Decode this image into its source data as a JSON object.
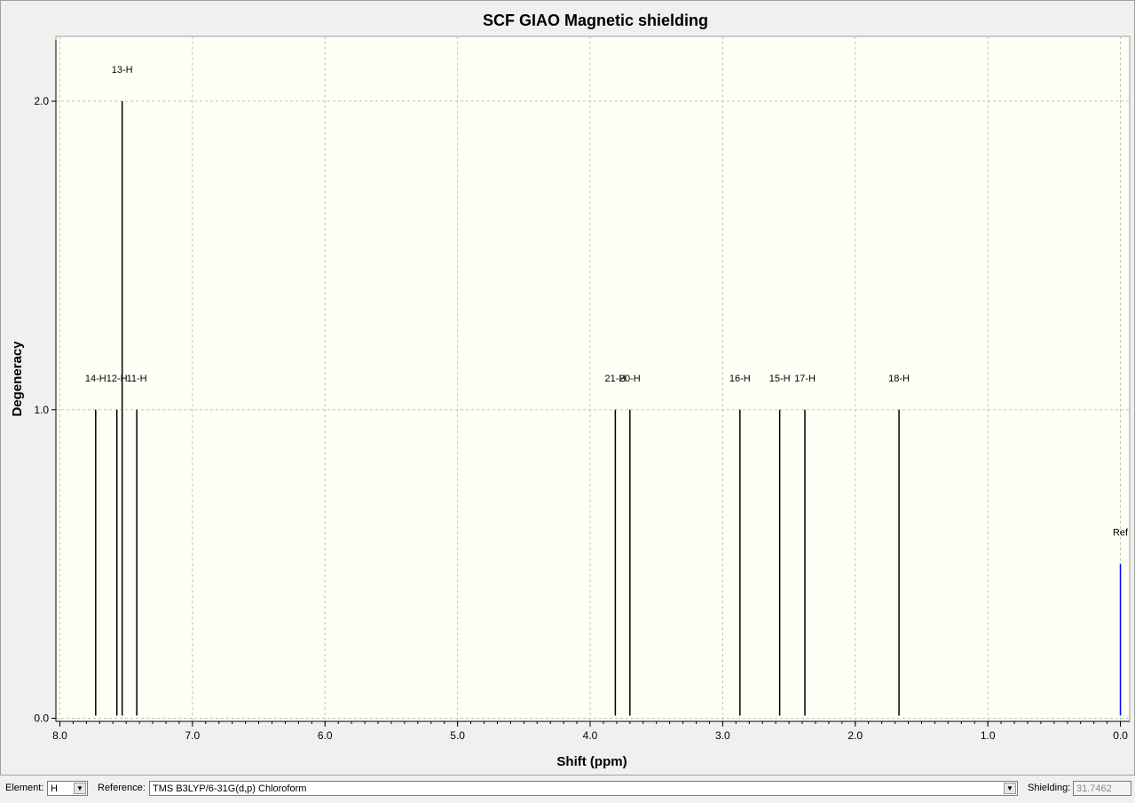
{
  "chart_data": {
    "type": "bar",
    "title": "SCF GIAO Magnetic shielding",
    "xlabel": "Shift (ppm)",
    "ylabel": "Degeneracy",
    "xlim": [
      8.03,
      -0.07
    ],
    "ylim": [
      -0.01,
      2.21
    ],
    "xticks": [
      "8.0",
      "7.0",
      "6.0",
      "5.0",
      "4.0",
      "3.0",
      "2.0",
      "1.0",
      "0.0"
    ],
    "yticks": [
      "0.0",
      "1.0",
      "2.0"
    ],
    "grid": true,
    "peaks": [
      {
        "label": "14-H",
        "x": 7.73,
        "y": 1
      },
      {
        "label": "12-H",
        "x": 7.57,
        "y": 1
      },
      {
        "label": "13-H",
        "x": 7.53,
        "y": 2
      },
      {
        "label": "11-H",
        "x": 7.42,
        "y": 1
      },
      {
        "label": "21-H",
        "x": 3.81,
        "y": 1
      },
      {
        "label": "20-H",
        "x": 3.7,
        "y": 1
      },
      {
        "label": "16-H",
        "x": 2.87,
        "y": 1
      },
      {
        "label": "15-H",
        "x": 2.57,
        "y": 1
      },
      {
        "label": "17-H",
        "x": 2.38,
        "y": 1
      },
      {
        "label": "18-H",
        "x": 1.67,
        "y": 1
      },
      {
        "label": "Ref",
        "x": 0.0,
        "y": 0.5,
        "color": "#0000ff"
      }
    ]
  },
  "controls": {
    "element_label": "Element:",
    "element_value": "H",
    "reference_label": "Reference:",
    "reference_value": "TMS B3LYP/6-31G(d,p) Chloroform",
    "shielding_label": "Shielding:",
    "shielding_value": "31.7462"
  }
}
